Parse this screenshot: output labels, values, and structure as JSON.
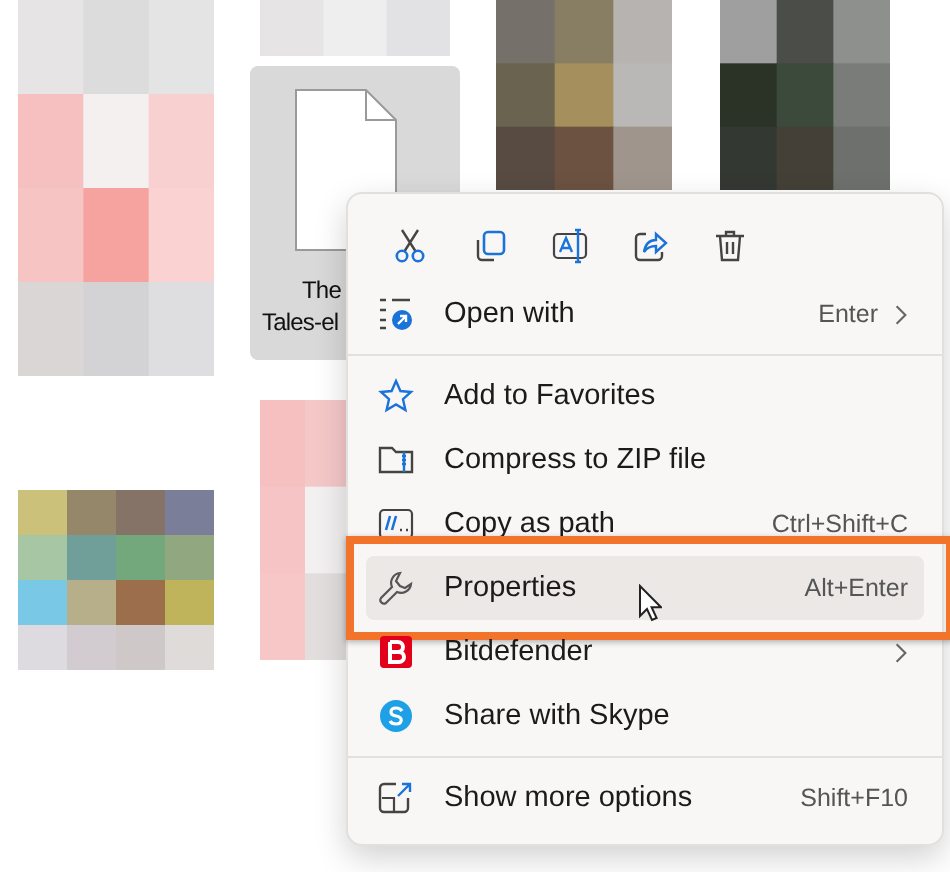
{
  "file_tile": {
    "selected": true,
    "label_lines": [
      "The",
      "Tales-el"
    ]
  },
  "context_menu": {
    "toolbar": [
      {
        "kind": "cut"
      },
      {
        "kind": "copy"
      },
      {
        "kind": "rename"
      },
      {
        "kind": "share"
      },
      {
        "kind": "delete"
      }
    ],
    "items": [
      {
        "kind": "open",
        "label": "Open with",
        "shortcut": "Enter",
        "submenu": true,
        "selected": false
      },
      {
        "kind": "star",
        "label": "Add to Favorites",
        "selected": false
      },
      {
        "kind": "zip",
        "label": "Compress to ZIP file",
        "selected": false
      },
      {
        "kind": "path",
        "label": "Copy as path",
        "shortcut": "Ctrl+Shift+C",
        "selected": false
      },
      {
        "kind": "wrench",
        "label": "Properties",
        "shortcut": "Alt+Enter",
        "selected": true
      },
      {
        "kind": "bitdefender",
        "label": "Bitdefender",
        "submenu": true,
        "selected": false
      },
      {
        "kind": "skype",
        "label": "Share with Skype",
        "selected": false
      },
      {
        "kind": "more",
        "label": "Show more options",
        "shortcut": "Shift+F10",
        "separator_before": true,
        "selected": false
      }
    ]
  }
}
